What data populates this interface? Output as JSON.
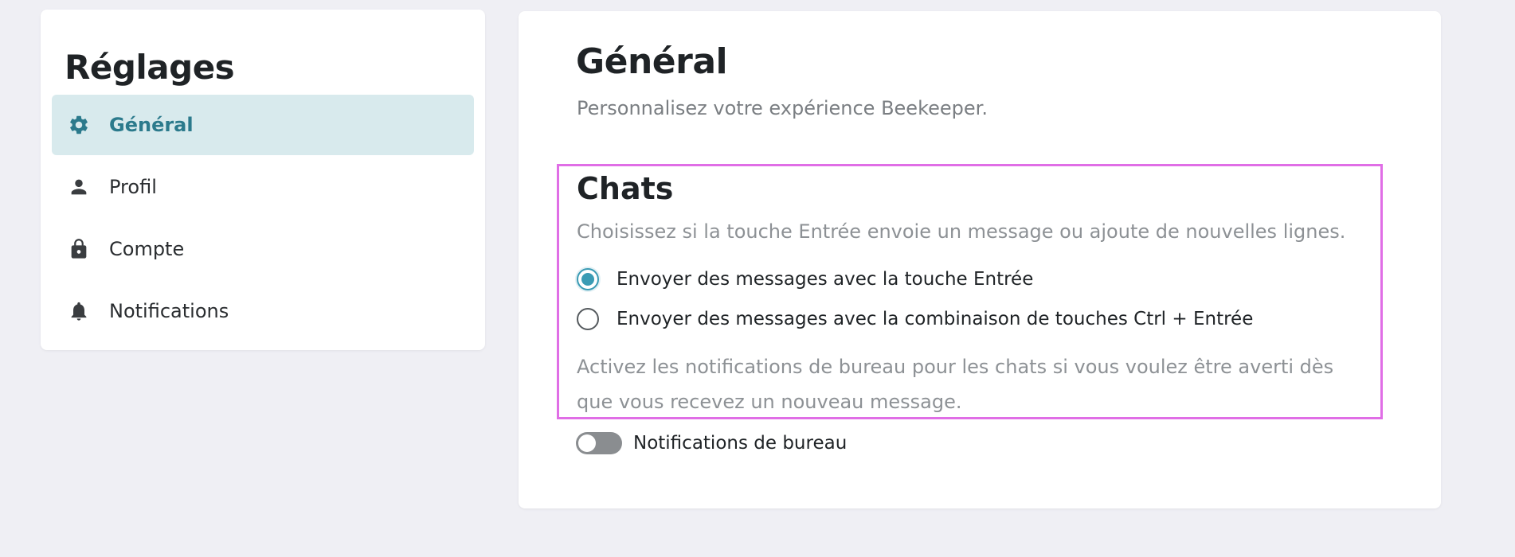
{
  "sidebar": {
    "title": "Réglages",
    "items": [
      {
        "label": "Général",
        "icon": "gear-icon",
        "active": true
      },
      {
        "label": "Profil",
        "icon": "person-icon",
        "active": false
      },
      {
        "label": "Compte",
        "icon": "lock-icon",
        "active": false
      },
      {
        "label": "Notifications",
        "icon": "bell-icon",
        "active": false
      }
    ]
  },
  "main": {
    "title": "Général",
    "subtitle": "Personnalisez votre expérience Beekeeper.",
    "chats": {
      "title": "Chats",
      "description": "Choisissez si la touche Entrée envoie un message ou ajoute de nouvelles lignes.",
      "options": [
        {
          "label": "Envoyer des messages avec la touche Entrée",
          "checked": true
        },
        {
          "label": "Envoyer des messages avec la combinaison de touches Ctrl + Entrée",
          "checked": false
        }
      ],
      "notifications_description": "Activez les notifications de bureau pour les chats si vous voulez être averti dès que vous recevez un nouveau message."
    },
    "desktop_notifications": {
      "label": "Notifications de bureau",
      "enabled": false
    }
  },
  "colors": {
    "accent": "#3a9bb4",
    "active_bg": "#d8eaed",
    "active_text": "#2b7a8c",
    "highlight_border": "#e06ee6",
    "background": "#efeff4"
  }
}
